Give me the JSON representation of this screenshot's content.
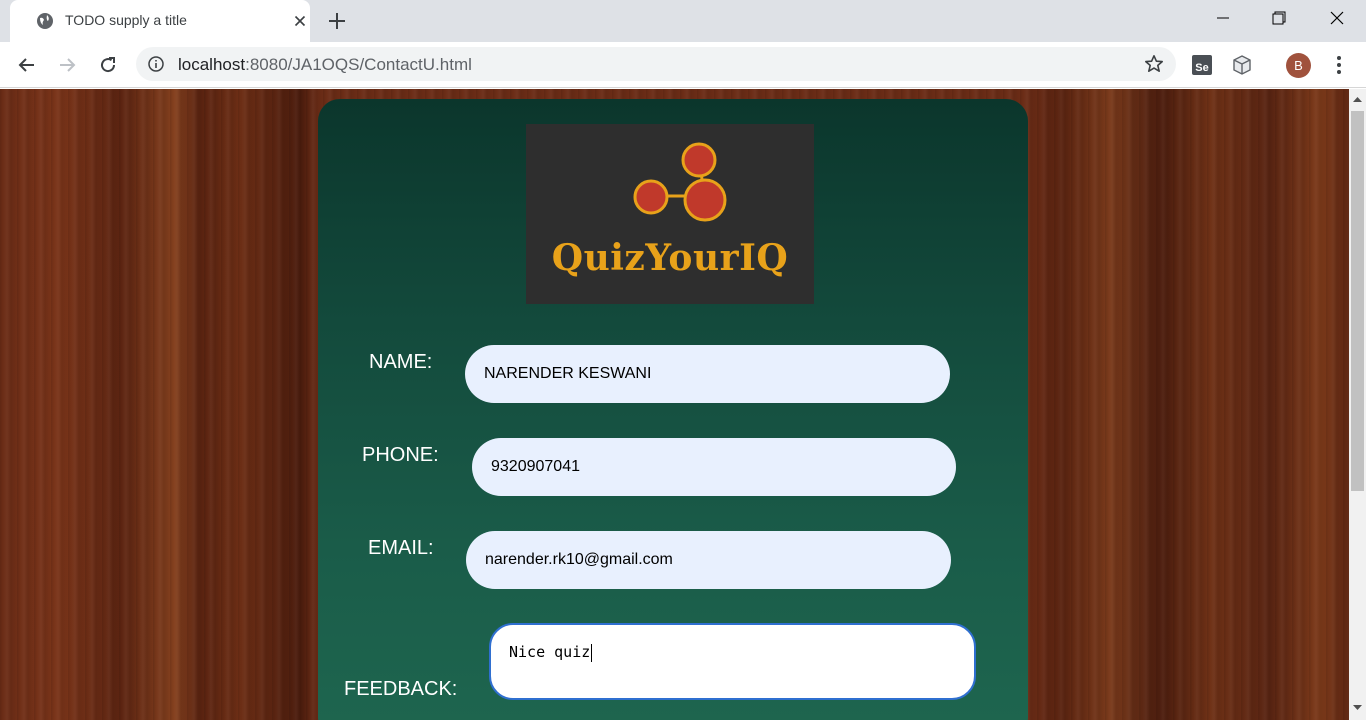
{
  "browser": {
    "tab_title": "TODO supply a title",
    "url_host": "localhost",
    "url_path": ":8080/JA1OQS/ContactU.html",
    "profile_initial": "B",
    "extension_label": "Se"
  },
  "page": {
    "logo_text": "QuizYourIQ",
    "form": {
      "name_label": "NAME:",
      "name_value": "NARENDER KESWANI",
      "phone_label": "PHONE:",
      "phone_value": "9320907041",
      "email_label": "EMAIL:",
      "email_value": "narender.rk10@gmail.com",
      "feedback_label": "FEEDBACK:",
      "feedback_value": "Nice quiz"
    }
  },
  "colors": {
    "panel_top": "#0b362c",
    "panel_bottom": "#1e664f",
    "logo_gold": "#e8a21a",
    "logo_node": "#c0392b",
    "input_bg": "#e8f0fe"
  },
  "icons": [
    "globe-icon",
    "close-icon",
    "plus-icon",
    "minimize-icon",
    "restore-icon",
    "window-close-icon",
    "back-icon",
    "forward-icon",
    "reload-icon",
    "info-icon",
    "star-icon",
    "selenium-icon",
    "extension-icon",
    "menu-icon"
  ]
}
